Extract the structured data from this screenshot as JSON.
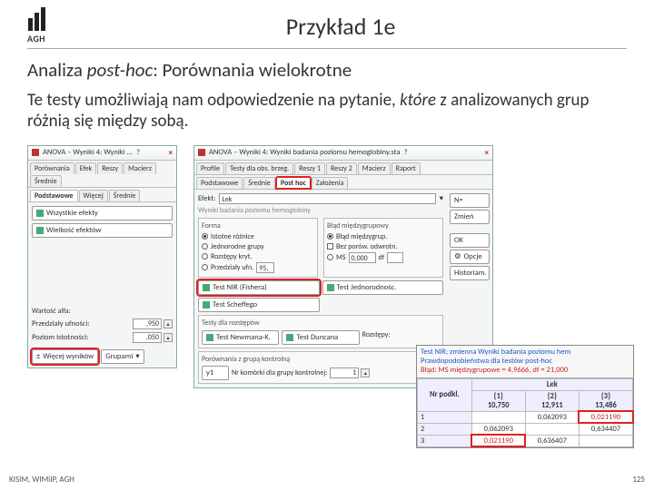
{
  "logo_text": "AGH",
  "slide_title": "Przykład 1e",
  "subtitle_pre": "Analiza ",
  "subtitle_ital": "post-hoc",
  "subtitle_post": ": Porównania wielokrotne",
  "body_pre": "Te testy umożliwiają nam odpowiedzenie na pytanie, ",
  "body_ital": "które",
  "body_post": " z analizowanych grup różnią się między sobą.",
  "dlg1": {
    "title": "ANOVA – Wyniki 4: Wyniki ...",
    "qmark": "?",
    "close": "×",
    "tabs": [
      "Porównania",
      "Efek",
      "Reszy",
      "Macierz",
      "Średnie"
    ],
    "tabs2_a": "Podstawowe",
    "tabs2_b": "Więcej",
    "tabs2_c": "Średnie",
    "btn1": "Wszystkie efekty",
    "btn2": "Wielkość efektów",
    "alpha_label": "Wartość alfa:",
    "alpha_row1_label": "Przedziały ufności:",
    "alpha_row1_val": ",950",
    "alpha_row2_label": "Poziom istotności:",
    "alpha_row2_val": ",050",
    "more": "Więcej wyników",
    "groups": "Grupami"
  },
  "dlg2": {
    "title": "ANOVA – Wyniki 4: Wyniki badania poziomu hemoglobiny.sta",
    "qmark": "?",
    "close": "×",
    "tabs": [
      "Profile",
      "Testy dla obs. brzeg.",
      "Reszy 1",
      "Reszy 2",
      "Macierz",
      "Raport"
    ],
    "tabs2": [
      "Podstawowe",
      "Średnie",
      "Post hoc",
      "Założenia"
    ],
    "effect_label": "Efekt:",
    "effect_value": "Lek",
    "section_title": "Wyniki badania poziomu hemoglobiny",
    "grp_forms": "Forma",
    "r_istot": "Istotne różnice",
    "r_jedn": "Jednorodne grupy",
    "r_roz": "Rozstępy kryt.",
    "r_prz": "Przedziały ufn.",
    "grp_blad": "Błąd międzygrupowy",
    "r_blad": "Błąd międzygrup.",
    "c_bez": "Bez porów. odwrotn.",
    "ms_label": "MS",
    "ms_val": "0,000",
    "df_label": "df",
    "btn_nir": "Test NIR (Fishera)",
    "btn_jr": "Test Jednorodnośc.",
    "btn_scheffe": "Test Scheffego",
    "grp_tests": "Testy dla rozstępów",
    "btn_nk": "Test Newmana-K.",
    "btn_duncan": "Test Duncana",
    "rozstępy": "Rozstępy:",
    "grp_kontrol": "Porównania z grupą kontrolną",
    "y1": "y1",
    "kontrol_label": "Nr komórki dla grupy kontrolnej:",
    "kontrol_val": "1",
    "side_n": "N=",
    "side_zmien": "Zmień",
    "side_ok": "OK",
    "side_opcje": "Opcje",
    "side_hist": "Historiam."
  },
  "results": {
    "hdr1": "Test NIR; zmienna Wyniki badania poziomu hem",
    "hdr2": "Prawdopodobieństwa dla testów post-hoc",
    "hdr3a": "Błąd: MS międzygrupowe = 4,9666, df = 21,000",
    "col0": "Nr podkl.",
    "col_top": "Lek",
    "col1": "{1}",
    "col2": "{2}",
    "col3": "{3}",
    "m1": "10,750",
    "m2": "12,911",
    "m3": "13,486",
    "r1": "1",
    "r2": "2",
    "r3": "3",
    "c12": "0,062093",
    "c13": "0,021190",
    "c21": "0,062093",
    "c23": "0,634407",
    "c31": "0,021190",
    "c32": "0,636407"
  },
  "footer_left": "KISIM, WIMiIP, AGH",
  "footer_right": "125"
}
